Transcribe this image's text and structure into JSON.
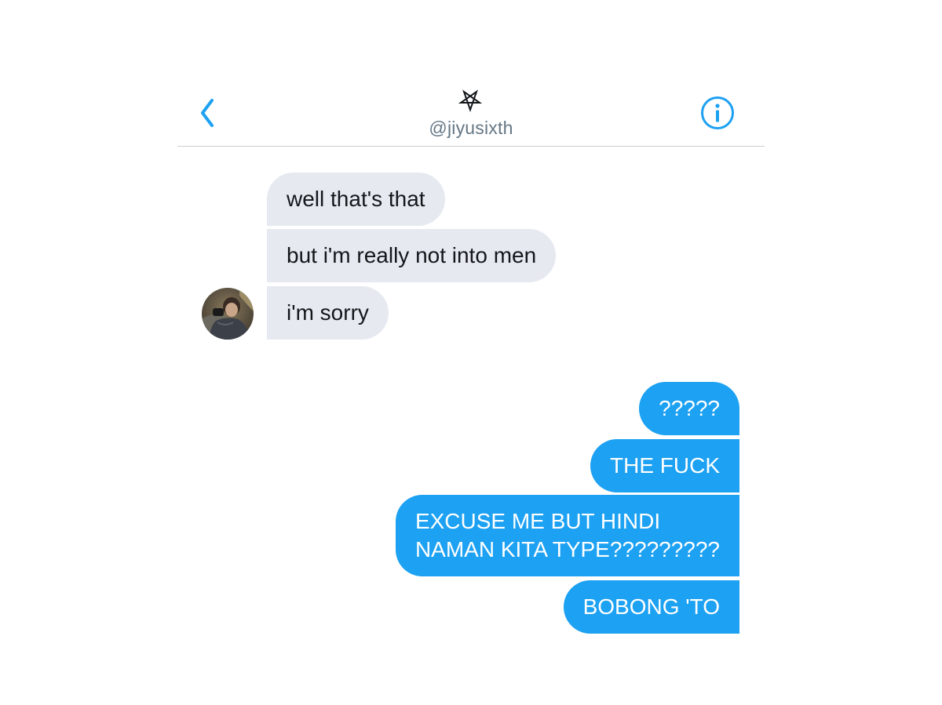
{
  "header": {
    "handle": "@jiyusixth",
    "back_icon": "chevron-left-icon",
    "info_icon": "info-circle-icon",
    "name_icon": "pentagram-icon"
  },
  "colors": {
    "accent": "#1da1f2",
    "incoming_bubble": "#e6e9f0",
    "handle_text": "#657786"
  },
  "messages": {
    "incoming": [
      "well that's that",
      "but i'm really not into men",
      "i'm sorry"
    ],
    "outgoing": [
      "?????",
      "THE FUCK",
      "EXCUSE ME BUT HINDI\nNAMAN KITA TYPE?????????",
      "BOBONG 'TO"
    ]
  }
}
